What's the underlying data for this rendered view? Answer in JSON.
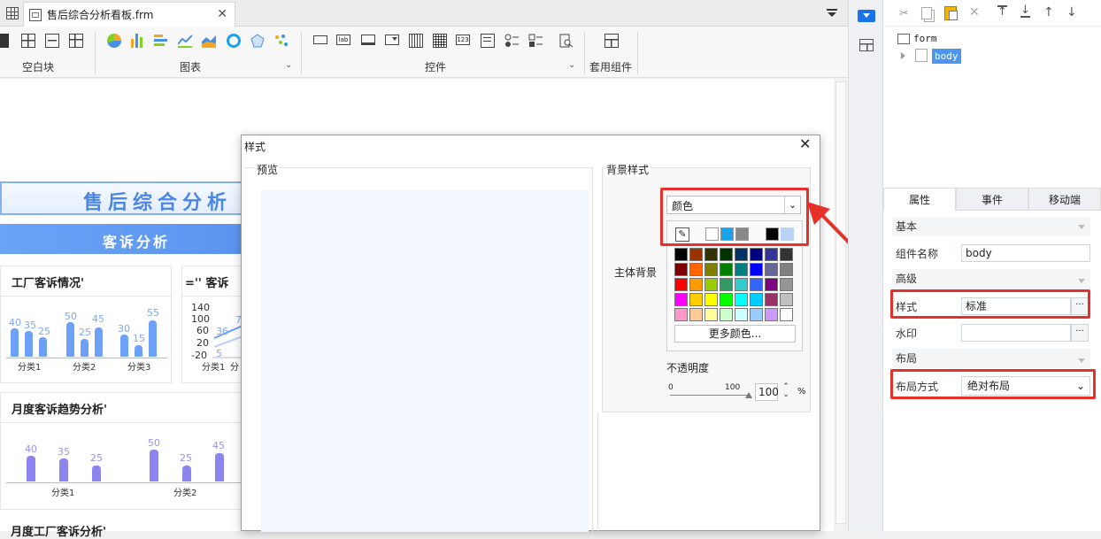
{
  "tab": {
    "title": "售后综合分析看板.frm"
  },
  "ribbon": {
    "groups": [
      "空白块",
      "图表",
      "控件",
      "套用组件"
    ]
  },
  "dashboard": {
    "title": "售后综合分析",
    "section_banner": "客诉分析",
    "card1": {
      "title": "工厂客诉情况'",
      "categories": [
        "分类1",
        "分类2",
        "分类3"
      ],
      "values": [
        40,
        35,
        25,
        50,
        25,
        45,
        30,
        15,
        55
      ]
    },
    "card2": {
      "title": "='' 客诉",
      "yticks": [
        "140",
        "100",
        "60",
        "20",
        "-20"
      ],
      "labels": [
        "36",
        "7",
        "5"
      ],
      "categories": [
        "分类1",
        "分"
      ]
    },
    "card3": {
      "title": "月度客诉趋势分析'",
      "categories": [
        "分类1",
        "分类2"
      ],
      "values": [
        40,
        35,
        25,
        50,
        25,
        45
      ]
    },
    "bottom_title": "月度工厂客诉分析'"
  },
  "dialog": {
    "title": "样式",
    "preview_label": "预览",
    "bg_style_label": "背景样式",
    "main_bg_label": "主体背景",
    "color_type": "颜色",
    "more_colors": "更多颜色...",
    "opacity_label": "不透明度",
    "opacity_min": "0",
    "opacity_max": "100",
    "opacity_value": "100",
    "opacity_unit": "%",
    "recent_colors": [
      "#ffffff",
      "#1aa3e8",
      "#888888",
      "#ffffff",
      "#000000",
      "#b9d3f7"
    ],
    "palette": [
      [
        "#000000",
        "#993300",
        "#333300",
        "#003300",
        "#003366",
        "#000080",
        "#333399",
        "#333333"
      ],
      [
        "#800000",
        "#ff6600",
        "#808000",
        "#008000",
        "#008080",
        "#0000ff",
        "#666699",
        "#808080"
      ],
      [
        "#ff0000",
        "#ff9900",
        "#99cc00",
        "#339966",
        "#33cccc",
        "#3366ff",
        "#800080",
        "#969696"
      ],
      [
        "#ff00ff",
        "#ffcc00",
        "#ffff00",
        "#00ff00",
        "#00ffff",
        "#00ccff",
        "#993366",
        "#c0c0c0"
      ],
      [
        "#ff99cc",
        "#ffcc99",
        "#ffff99",
        "#ccffcc",
        "#ccffff",
        "#99ccff",
        "#cc99ff",
        "#ffffff"
      ]
    ]
  },
  "tree": {
    "root": "form",
    "child": "body"
  },
  "properties": {
    "tabs": [
      "属性",
      "事件",
      "移动端"
    ],
    "sections": {
      "basic": "基本",
      "advanced": "高级",
      "layout": "布局"
    },
    "component_name_label": "组件名称",
    "component_name_value": "body",
    "style_label": "样式",
    "style_value": "标准",
    "watermark_label": "水印",
    "watermark_value": "",
    "layout_mode_label": "布局方式",
    "layout_mode_value": "绝对布局"
  },
  "colors": {
    "accent": "#e8302a",
    "brand": "#4b86e6",
    "banner": "#6aa3f5"
  }
}
